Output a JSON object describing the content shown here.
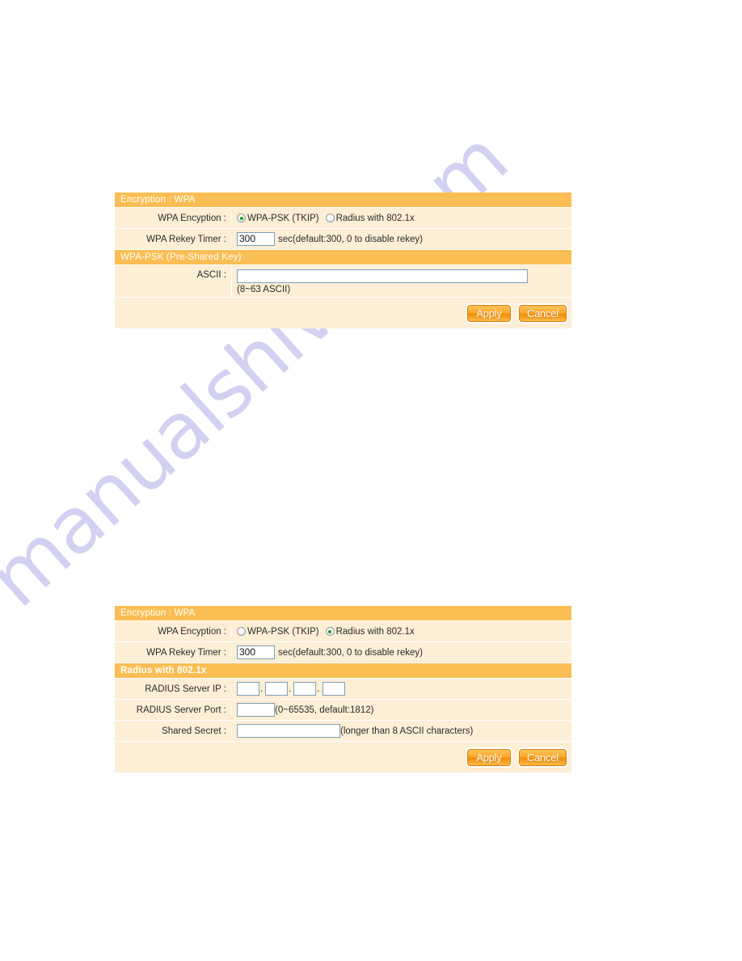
{
  "watermark": {
    "text": "manualshive.com",
    "color": "#b9b6ea"
  },
  "theme": {
    "header_orange": "#fbbe54",
    "row_cream": "#fdeed6",
    "button_orange": "#fba72b",
    "radio_green": "#13a313",
    "text": "#2b2b2b"
  },
  "panels": [
    {
      "id": "wpa-psk",
      "title": "Encryption : WPA",
      "encryption_label": "WPA Encyption :",
      "options": [
        {
          "label": "WPA-PSK (TKIP)",
          "selected": true
        },
        {
          "label": "Radius with 802.1x",
          "selected": false
        }
      ],
      "rekey_label": "WPA Rekey Timer :",
      "rekey_value": "300",
      "rekey_hint": "sec(default:300, 0 to disable rekey)",
      "section_title": "WPA-PSK (Pre-Shared Key)",
      "ascii_label": "ASCII :",
      "ascii_value": "",
      "ascii_note": "(8~63 ASCII)",
      "apply_label": "Apply",
      "cancel_label": "Cancel"
    },
    {
      "id": "radius-8021x",
      "title": "Encryption : WPA",
      "encryption_label": "WPA Encyption :",
      "options": [
        {
          "label": "WPA-PSK (TKIP)",
          "selected": false
        },
        {
          "label": "Radius with 802.1x",
          "selected": true
        }
      ],
      "rekey_label": "WPA Rekey Timer :",
      "rekey_value": "300",
      "rekey_hint": "sec(default:300, 0 to disable rekey)",
      "section_title": "Radius with 802.1x",
      "server_ip_label": "RADIUS Server IP :",
      "server_ip_octets": [
        "",
        "",
        "",
        ""
      ],
      "server_port_label": "RADIUS Server Port :",
      "server_port_value": "",
      "server_port_hint": "(0~65535, default:1812)",
      "shared_secret_label": "Shared Secret :",
      "shared_secret_value": "",
      "shared_secret_hint": "(longer than 8 ASCII characters)",
      "apply_label": "Apply",
      "cancel_label": "Cancel"
    }
  ]
}
